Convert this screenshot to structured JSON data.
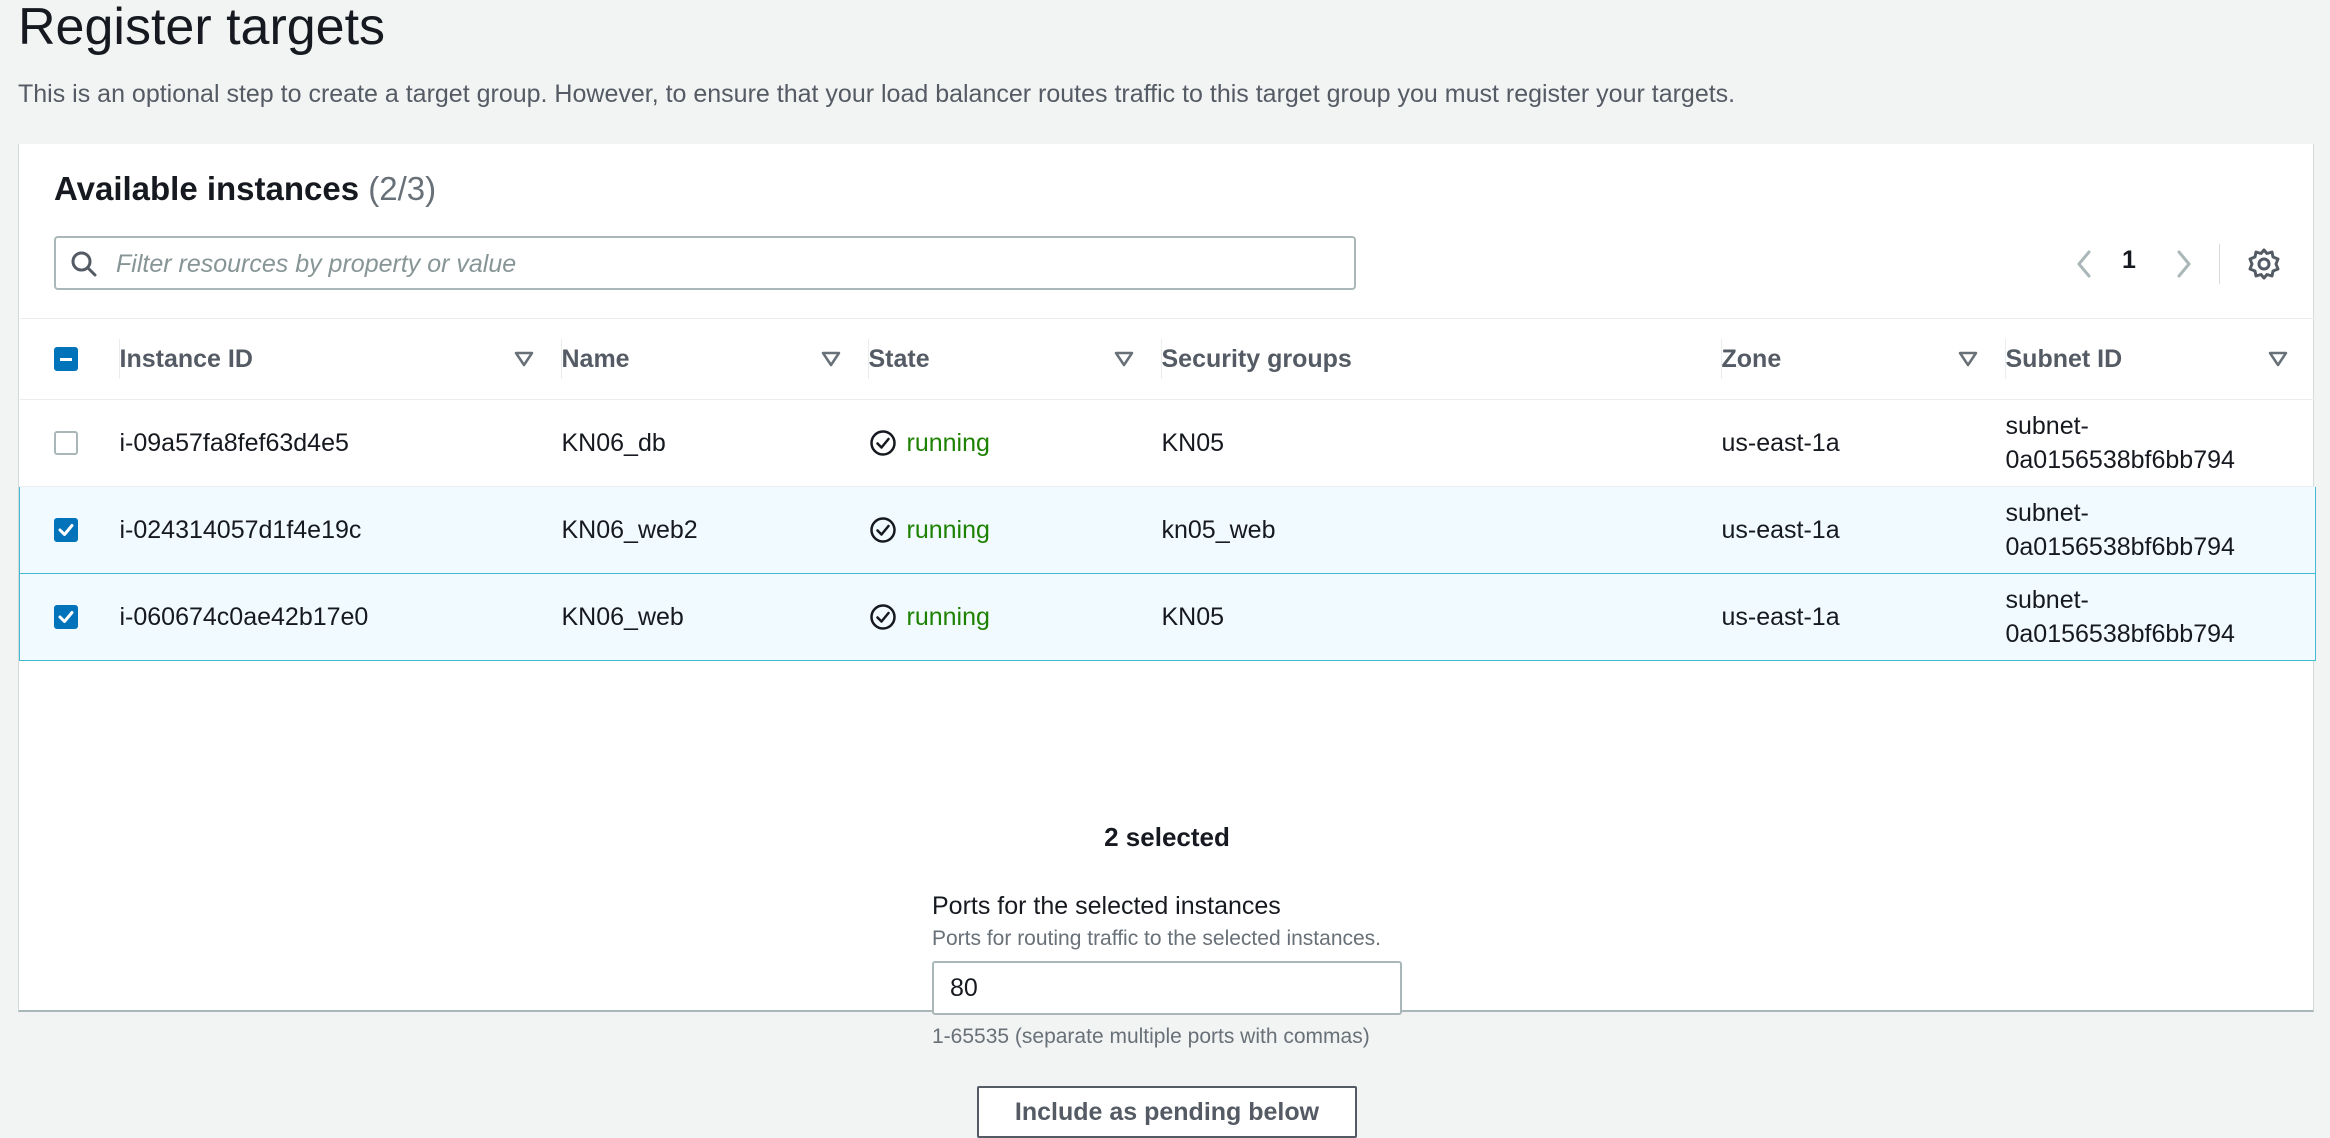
{
  "page": {
    "title": "Register targets",
    "description": "This is an optional step to create a target group. However, to ensure that your load balancer routes traffic to this target group you must register your targets."
  },
  "panel": {
    "title": "Available instances",
    "count": "(2/3)",
    "search_placeholder": "Filter resources by property or value",
    "page_number": "1"
  },
  "table": {
    "columns": [
      "Instance ID",
      "Name",
      "State",
      "Security groups",
      "Zone",
      "Subnet ID"
    ],
    "rows": [
      {
        "selected": false,
        "instance_id": "i-09a57fa8fef63d4e5",
        "name": "KN06_db",
        "state": "running",
        "security_groups": "KN05",
        "zone": "us-east-1a",
        "subnet_line1": "subnet-",
        "subnet_line2": "0a0156538bf6bb794"
      },
      {
        "selected": true,
        "instance_id": "i-024314057d1f4e19c",
        "name": "KN06_web2",
        "state": "running",
        "security_groups": "kn05_web",
        "zone": "us-east-1a",
        "subnet_line1": "subnet-",
        "subnet_line2": "0a0156538bf6bb794"
      },
      {
        "selected": true,
        "instance_id": "i-060674c0ae42b17e0",
        "name": "KN06_web",
        "state": "running",
        "security_groups": "KN05",
        "zone": "us-east-1a",
        "subnet_line1": "subnet-",
        "subnet_line2": "0a0156538bf6bb794"
      }
    ]
  },
  "selection": {
    "count_text": "2 selected"
  },
  "ports": {
    "label": "Ports for the selected instances",
    "description": "Ports for routing traffic to the selected instances.",
    "value": "80",
    "hint": "1-65535 (separate multiple ports with commas)"
  },
  "include_button_label": "Include as pending below",
  "colors": {
    "accent": "#0073bb",
    "running": "#1d8102",
    "selected_row_bg": "#f1faff",
    "selected_row_border": "#44b9d6"
  }
}
